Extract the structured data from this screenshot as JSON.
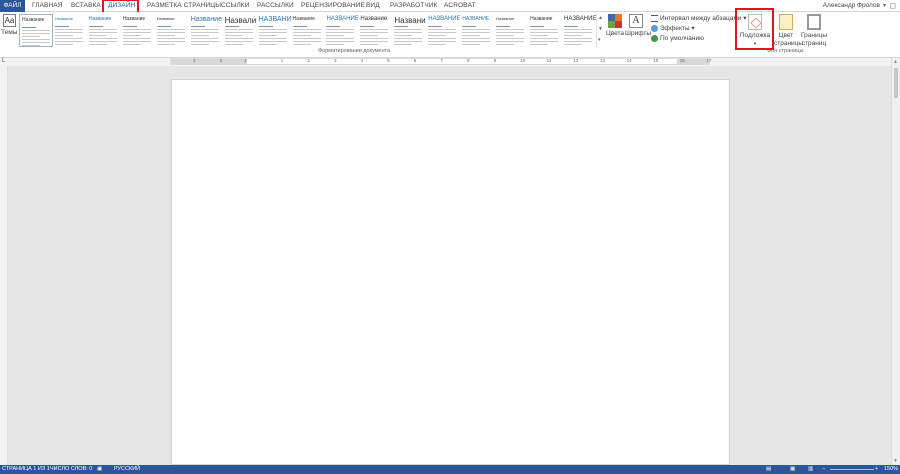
{
  "tabs": {
    "file": "ФАЙЛ",
    "items": [
      "ГЛАВНАЯ",
      "ВСТАВКА",
      "ДИЗАЙН",
      "РАЗМЕТКА СТРАНИЦЫ",
      "ССЫЛКИ",
      "РАССЫЛКИ",
      "РЕЦЕНЗИРОВАНИЕ",
      "ВИД",
      "РАЗРАБОТЧИК",
      "ACROBAT"
    ],
    "active": "ДИЗАЙН"
  },
  "user": {
    "name": "Александр Фролов"
  },
  "ribbon": {
    "themes_label": "Темы",
    "themes_icon": "Aa",
    "style_gallery": [
      {
        "title": "Название",
        "size": 5
      },
      {
        "title": "Название",
        "size": 4
      },
      {
        "title": "Название",
        "size": 5
      },
      {
        "title": "Название",
        "size": 5
      },
      {
        "title": "Название",
        "size": 4
      },
      {
        "title": "Название",
        "size": 7
      },
      {
        "title": "Назвали е",
        "size": 8
      },
      {
        "title": "НАЗВАНИЕ",
        "size": 7
      },
      {
        "title": "Название",
        "size": 5
      },
      {
        "title": "НАЗВАНИЕ",
        "size": 6
      },
      {
        "title": "Название",
        "size": 6
      },
      {
        "title": "Название",
        "size": 8
      },
      {
        "title": "НАЗВАНИЕ",
        "size": 6
      },
      {
        "title": "НАЗВАНИЕ",
        "size": 5
      },
      {
        "title": "Название",
        "size": 4
      },
      {
        "title": "Название",
        "size": 5
      },
      {
        "title": "НАЗВАНИЕ",
        "size": 6
      }
    ],
    "doc_format_label": "Форматирование документа",
    "colors_label": "Цвета",
    "fonts_label": "Шрифты",
    "fonts_icon": "A",
    "paragraph_spacing": "Интервал между абзацами",
    "effects": "Эффекты",
    "set_default": "По умолчанию",
    "watermark": "Подложка",
    "page_color": [
      "Цвет",
      "страницы"
    ],
    "page_borders": [
      "Границы",
      "страниц"
    ],
    "page_bg_label": "Фон страницы"
  },
  "ruler": {
    "numbers": [
      "3",
      "2",
      "1",
      "1",
      "2",
      "3",
      "4",
      "5",
      "6",
      "7",
      "8",
      "9",
      "10",
      "11",
      "12",
      "13",
      "14",
      "15",
      "16",
      "17"
    ]
  },
  "status": {
    "page": "СТРАНИЦА 1 ИЗ 1",
    "words": "ЧИСЛО СЛОВ: 0",
    "language": "РУССКИЙ",
    "zoom": "150%"
  },
  "colors": {
    "brand": "#2b579a",
    "highlight": "#e0141e"
  }
}
